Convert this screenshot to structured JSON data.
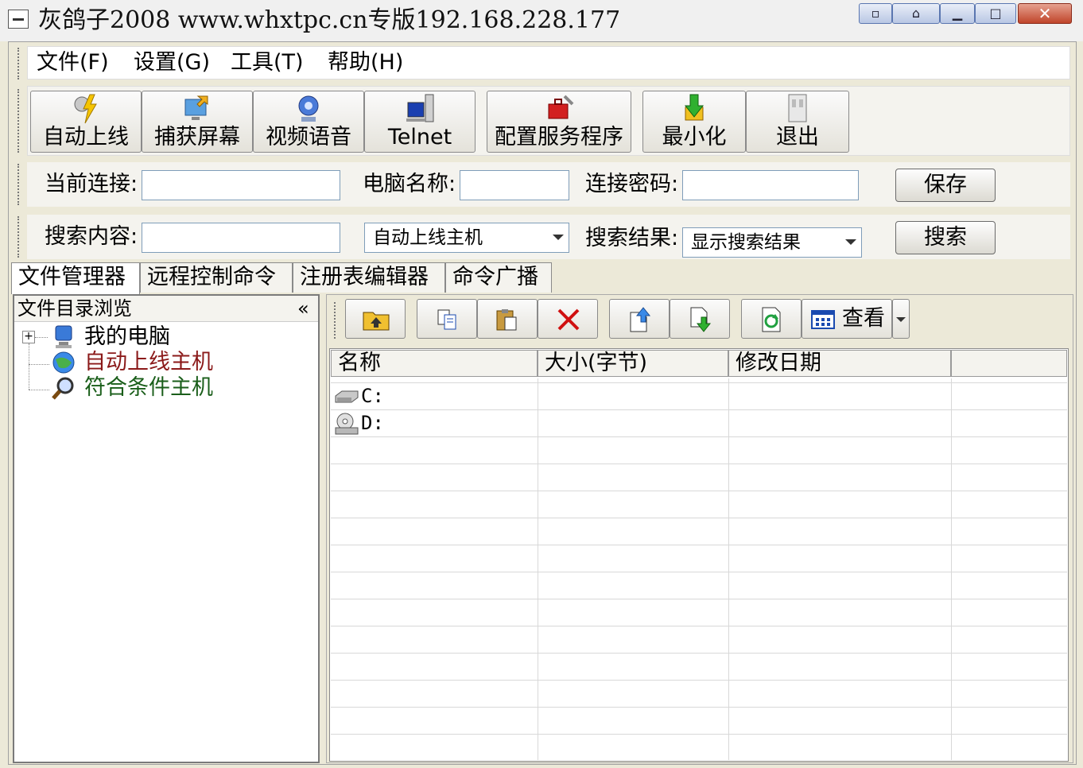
{
  "window": {
    "title": "灰鸽子2008 www.whxtpc.cn专版192.168.228.177"
  },
  "menu": [
    {
      "label": "文件(F)"
    },
    {
      "label": "设置(G)"
    },
    {
      "label": "工具(T)"
    },
    {
      "label": "帮助(H)"
    }
  ],
  "toolbar": {
    "auto_online": "自动上线",
    "capture_screen": "捕获屏幕",
    "video_voice": "视频语音",
    "telnet": "Telnet",
    "config_server": "配置服务程序",
    "minimize": "最小化",
    "exit": "退出"
  },
  "connection": {
    "current_label": "当前连接:",
    "current_value": "",
    "pc_name_label": "电脑名称:",
    "pc_name_value": "",
    "password_label": "连接密码:",
    "password_value": "",
    "save_button": "保存"
  },
  "search": {
    "content_label": "搜索内容:",
    "content_value": "",
    "scope_selected": "自动上线主机",
    "result_label": "搜索结果:",
    "result_selected": "显示搜索结果",
    "search_button": "搜索"
  },
  "tabs": [
    {
      "label": "文件管理器"
    },
    {
      "label": "远程控制命令"
    },
    {
      "label": "注册表编辑器"
    },
    {
      "label": "命令广播"
    }
  ],
  "tree": {
    "header": "文件目录浏览",
    "collapse_glyph": "«",
    "items": [
      {
        "label": "我的电脑",
        "color": "#000000"
      },
      {
        "label": "自动上线主机",
        "color": "#8b1a1a"
      },
      {
        "label": "符合条件主机",
        "color": "#1a5e1a"
      }
    ]
  },
  "file_toolbar": {
    "view_label": "查看"
  },
  "file_list": {
    "columns": [
      "名称",
      "大小(字节)",
      "修改日期"
    ],
    "rows": [
      {
        "name": "C:"
      },
      {
        "name": "D:"
      }
    ]
  },
  "colors": {
    "accent": "#316ac5",
    "delete_red": "#d01010"
  }
}
